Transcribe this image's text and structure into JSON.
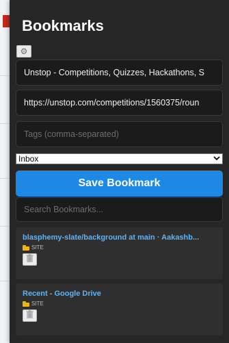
{
  "panel": {
    "title": "Bookmarks"
  },
  "form": {
    "title_value": "Unstop - Competitions, Quizzes, Hackathons, S",
    "url_value": "https://unstop.com/competitions/1560375/roun",
    "tags_placeholder": "Tags (comma-separated)",
    "folder_selected": "Inbox",
    "save_label": "Save Bookmark",
    "search_placeholder": "Search Bookmarks..."
  },
  "bookmarks": [
    {
      "title": "blasphemy-slate/background at main · Aakashb...",
      "type": "SITE"
    },
    {
      "title": "Recent - Google Drive",
      "type": "SITE"
    }
  ],
  "icons": {
    "settings": "gear-icon",
    "folder": "folder-icon",
    "delete": "trash-icon",
    "dropdown": "chevron-down-icon"
  },
  "colors": {
    "panel_bg": "#262626",
    "accent": "#1e88e5",
    "link": "#5fb3f5",
    "folder": "#f2b30f"
  }
}
